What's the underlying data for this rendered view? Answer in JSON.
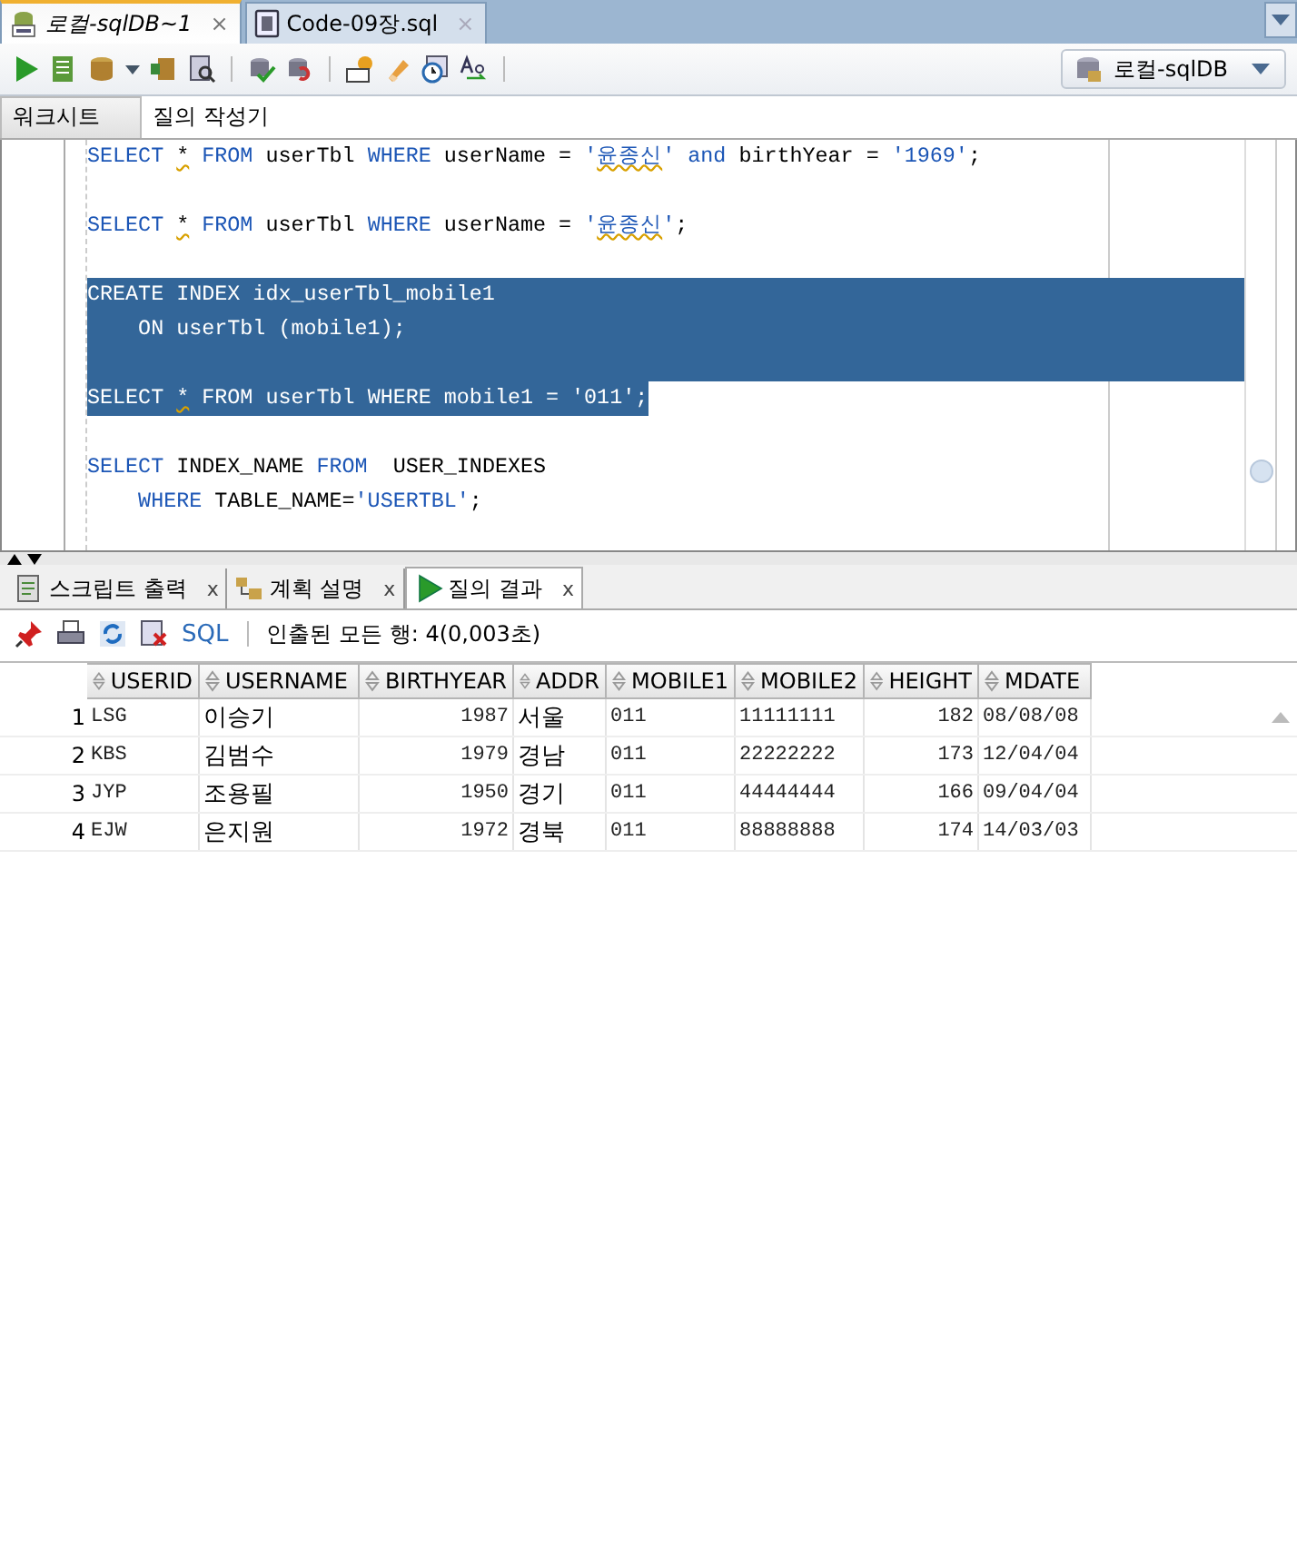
{
  "editor_tabs": [
    {
      "label": "로컬-sqlDB~1",
      "selected": true,
      "close": "×"
    },
    {
      "label": "Code-09장.sql",
      "selected": false,
      "close": "×"
    }
  ],
  "toolbar": {
    "connection": "로컬-sqlDB"
  },
  "worksheet_tabs": [
    {
      "label": "워크시트",
      "selected": true
    },
    {
      "label": "질의 작성기",
      "selected": false
    }
  ],
  "code_lines": [
    {
      "kind": "code",
      "selected": false,
      "tokens": [
        {
          "text": "SELECT ",
          "kind": "keyword"
        },
        {
          "text": "*",
          "kind": "warn"
        },
        {
          "text": " FROM ",
          "kind": "keyword"
        },
        {
          "text": "userTbl ",
          "kind": "ident"
        },
        {
          "text": "WHERE ",
          "kind": "keyword"
        },
        {
          "text": "userName = ",
          "kind": "ident"
        },
        {
          "text": "'",
          "kind": "string"
        },
        {
          "text": "윤종신",
          "kind": "warnstring"
        },
        {
          "text": "'",
          "kind": "string"
        },
        {
          "text": " and ",
          "kind": "keyword"
        },
        {
          "text": "birthYear = ",
          "kind": "ident"
        },
        {
          "text": "'1969'",
          "kind": "string"
        },
        {
          "text": ";",
          "kind": "ident"
        }
      ]
    },
    {
      "kind": "blank",
      "selected": false
    },
    {
      "kind": "code",
      "selected": false,
      "tokens": [
        {
          "text": "SELECT ",
          "kind": "keyword"
        },
        {
          "text": "*",
          "kind": "warn"
        },
        {
          "text": " FROM ",
          "kind": "keyword"
        },
        {
          "text": "userTbl ",
          "kind": "ident"
        },
        {
          "text": "WHERE ",
          "kind": "keyword"
        },
        {
          "text": "userName = ",
          "kind": "ident"
        },
        {
          "text": "'",
          "kind": "string"
        },
        {
          "text": "윤종신",
          "kind": "warnstring"
        },
        {
          "text": "'",
          "kind": "string"
        },
        {
          "text": ";",
          "kind": "ident"
        }
      ]
    },
    {
      "kind": "blank",
      "selected": false
    },
    {
      "kind": "code",
      "selected": true,
      "tokens": [
        {
          "text": "CREATE INDEX idx_userTbl_mobile1",
          "kind": "ident"
        }
      ]
    },
    {
      "kind": "code",
      "selected": true,
      "tokens": [
        {
          "text": "    ON userTbl (mobile1);",
          "kind": "ident"
        }
      ]
    },
    {
      "kind": "blank",
      "selected": true
    },
    {
      "kind": "code",
      "selected": true,
      "tokens": [
        {
          "text": "SELECT ",
          "kind": "ident"
        },
        {
          "text": "*",
          "kind": "warn"
        },
        {
          "text": " FROM userTbl WHERE mobile1 = '011';",
          "kind": "ident"
        }
      ]
    },
    {
      "kind": "blank",
      "selected": false
    },
    {
      "kind": "code",
      "selected": false,
      "tokens": [
        {
          "text": "SELECT ",
          "kind": "keyword"
        },
        {
          "text": "INDEX_NAME ",
          "kind": "ident"
        },
        {
          "text": "FROM",
          "kind": "keyword"
        },
        {
          "text": "  USER_INDEXES",
          "kind": "ident"
        }
      ]
    },
    {
      "kind": "code",
      "selected": false,
      "tokens": [
        {
          "text": "    WHERE ",
          "kind": "keyword"
        },
        {
          "text": "TABLE_NAME=",
          "kind": "ident"
        },
        {
          "text": "'USERTBL'",
          "kind": "string"
        },
        {
          "text": ";",
          "kind": "ident"
        }
      ]
    }
  ],
  "output_tabs": [
    {
      "label": "스크립트 출력",
      "selected": false,
      "close": "x"
    },
    {
      "label": "계획 설명",
      "selected": false,
      "close": "x"
    },
    {
      "label": "질의 결과",
      "selected": true,
      "close": "x"
    }
  ],
  "result_toolbar": {
    "sql_label": "SQL",
    "status": "인출된 모든 행: 4(0,003초)"
  },
  "table": {
    "columns": [
      "USERID",
      "USERNAME",
      "BIRTHYEAR",
      "ADDR",
      "MOBILE1",
      "MOBILE2",
      "HEIGHT",
      "MDATE"
    ],
    "rows": [
      {
        "num": "1",
        "cells": [
          "LSG",
          "이승기",
          "1987",
          "서울",
          "011",
          "11111111",
          "182",
          "08/08/08"
        ]
      },
      {
        "num": "2",
        "cells": [
          "KBS",
          "김범수",
          "1979",
          "경남",
          "011",
          "22222222",
          "173",
          "12/04/04"
        ]
      },
      {
        "num": "3",
        "cells": [
          "JYP",
          "조용필",
          "1950",
          "경기",
          "011",
          "44444444",
          "166",
          "09/04/04"
        ]
      },
      {
        "num": "4",
        "cells": [
          "EJW",
          "은지원",
          "1972",
          "경북",
          "011",
          "88888888",
          "174",
          "14/03/03"
        ]
      }
    ]
  }
}
